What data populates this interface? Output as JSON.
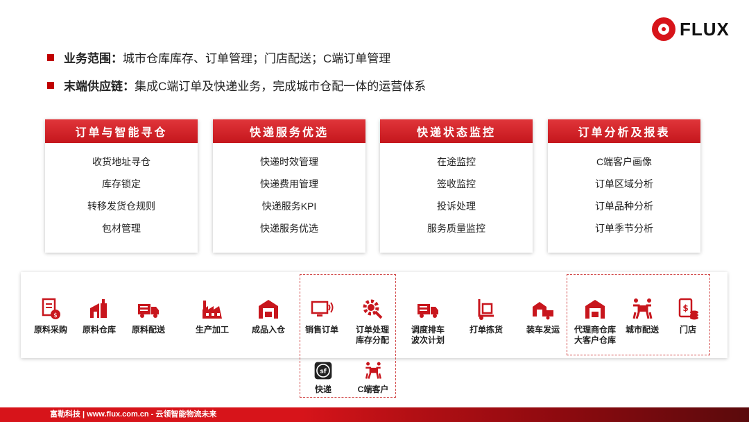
{
  "brand": {
    "name": "FLUX"
  },
  "bullets": [
    {
      "key": "业务范围",
      "sep": "：",
      "text": "城市仓库库存、订单管理；门店配送；C端订单管理"
    },
    {
      "key": "末端供应链",
      "sep": "：",
      "text": "集成C端订单及快递业务，完成城市仓配一体的运营体系"
    }
  ],
  "cards": [
    {
      "title": "订单与智能寻仓",
      "items": [
        "收货地址寻仓",
        "库存锁定",
        "转移发货仓规则",
        "包材管理"
      ]
    },
    {
      "title": "快递服务优选",
      "items": [
        "快递时效管理",
        "快递费用管理",
        "快递服务KPI",
        "快递服务优选"
      ]
    },
    {
      "title": "快递状态监控",
      "items": [
        "在途监控",
        "签收监控",
        "投诉处理",
        "服务质量监控"
      ]
    },
    {
      "title": "订单分析及报表",
      "items": [
        "C端客户画像",
        "订单区域分析",
        "订单品种分析",
        "订单季节分析"
      ]
    }
  ],
  "flow": {
    "items": [
      {
        "label": "原料采购",
        "icon": "document-money-icon"
      },
      {
        "label": "原料仓库",
        "icon": "warehouse-icon"
      },
      {
        "label": "原料配送",
        "icon": "delivery-truck-icon"
      },
      {
        "label": "生产加工",
        "icon": "factory-icon"
      },
      {
        "label": "成品入仓",
        "icon": "warehouse-in-icon"
      },
      {
        "label": "销售订单",
        "icon": "monitor-order-icon"
      },
      {
        "label": "订单处理\n库存分配",
        "icon": "gear-wrench-icon"
      },
      {
        "label": "调度排车\n波次计划",
        "icon": "truck-schedule-icon"
      },
      {
        "label": "打单拣货",
        "icon": "hand-truck-icon"
      },
      {
        "label": "装车发运",
        "icon": "loading-truck-icon"
      },
      {
        "label": "代理商仓库\n大客户仓库",
        "icon": "agent-warehouse-icon"
      },
      {
        "label": "城市配送",
        "icon": "courier-icon"
      },
      {
        "label": "门店",
        "icon": "store-money-icon"
      }
    ],
    "extra": [
      {
        "label": "快递",
        "icon": "sf-express-icon"
      },
      {
        "label": "C端客户",
        "icon": "customer-parcel-icon"
      }
    ]
  },
  "footer": {
    "text": "富勒科技 | www.flux.com.cn  -  云领智能物流未来"
  },
  "colors": {
    "accent": "#d7141a",
    "dark_red": "#5a0a0c"
  }
}
